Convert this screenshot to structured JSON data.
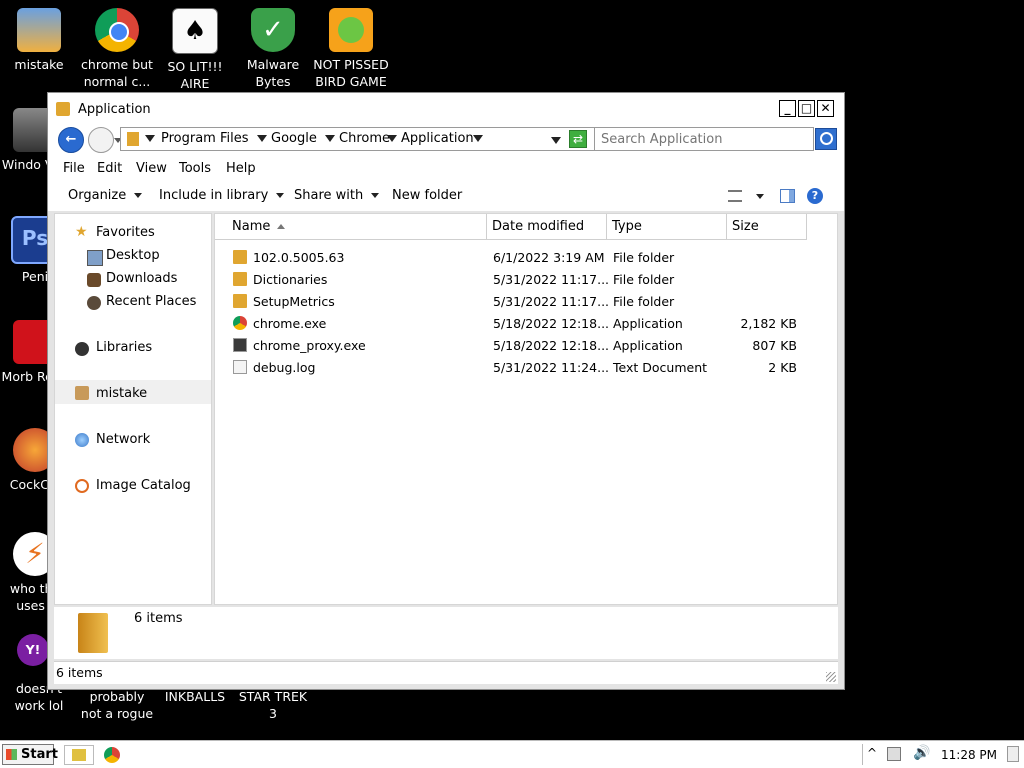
{
  "desktop": {
    "icons": [
      {
        "label": "mistake"
      },
      {
        "label": "chrome but normal c..."
      },
      {
        "label": "SO LIT!!! AIRE"
      },
      {
        "label": "Malware Bytes"
      },
      {
        "label": "NOT PISSED BIRD GAME"
      },
      {
        "label": "Windo Vist"
      },
      {
        "label": "Peni"
      },
      {
        "label": "Morb Read"
      },
      {
        "label": "CockCle"
      },
      {
        "label": "who the uses t"
      },
      {
        "label": "doesn't work lol"
      },
      {
        "label": "probably not a rogue"
      },
      {
        "label": "INKBALLS"
      },
      {
        "label": "STAR TREK 3"
      }
    ]
  },
  "window": {
    "title": "Application",
    "buttons": {
      "minimize": "_",
      "maximize": "□",
      "close": "✕"
    },
    "breadcrumbs": [
      "Program Files",
      "Google",
      "Chrome",
      "Application"
    ],
    "search_placeholder": "Search Application",
    "menu": [
      "File",
      "Edit",
      "View",
      "Tools",
      "Help"
    ],
    "toolbar": {
      "organize": "Organize",
      "include": "Include in library",
      "share": "Share with",
      "new_folder": "New folder"
    },
    "nav": {
      "favorites": "Favorites",
      "desktop": "Desktop",
      "downloads": "Downloads",
      "recent": "Recent Places",
      "libraries": "Libraries",
      "user": "mistake",
      "network": "Network",
      "catalog": "Image Catalog"
    },
    "columns": [
      "Name",
      "Date modified",
      "Type",
      "Size"
    ],
    "files": [
      {
        "name": "102.0.5005.63",
        "date": "6/1/2022 3:19 AM",
        "type": "File folder",
        "size": ""
      },
      {
        "name": "Dictionaries",
        "date": "5/31/2022 11:17...",
        "type": "File folder",
        "size": ""
      },
      {
        "name": "SetupMetrics",
        "date": "5/31/2022 11:17...",
        "type": "File folder",
        "size": ""
      },
      {
        "name": "chrome.exe",
        "date": "5/18/2022 12:18...",
        "type": "Application",
        "size": "2,182 KB"
      },
      {
        "name": "chrome_proxy.exe",
        "date": "5/18/2022 12:18...",
        "type": "Application",
        "size": "807 KB"
      },
      {
        "name": "debug.log",
        "date": "5/31/2022 11:24...",
        "type": "Text Document",
        "size": "2 KB"
      }
    ],
    "details_count": "6 items",
    "status_count": "6 items"
  },
  "taskbar": {
    "start": "Start",
    "time": "11:28 PM"
  },
  "colors": {
    "folder": "#e0a630",
    "nav_selected": "#f0f0f0",
    "green_go": "#3fae3f",
    "search_blue": "#2f6fcf"
  }
}
